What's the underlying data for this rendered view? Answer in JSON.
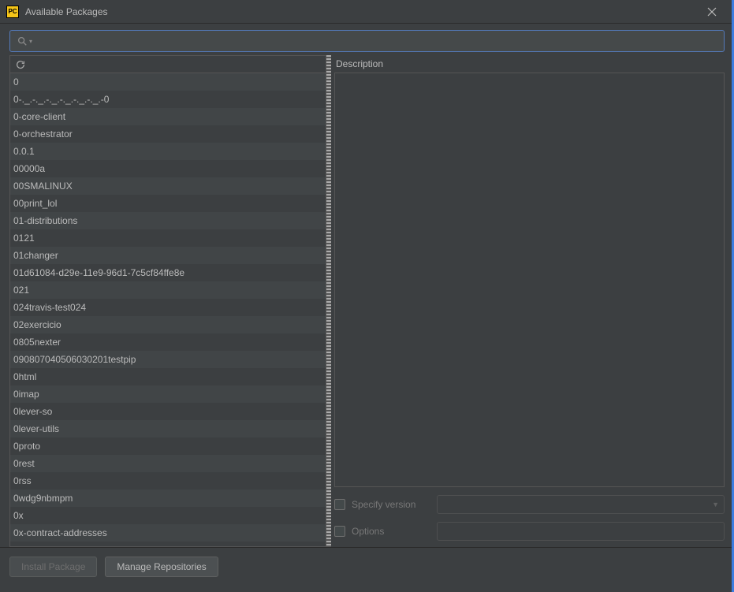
{
  "window": {
    "app_icon_text": "PC",
    "title": "Available Packages"
  },
  "search": {
    "value": "",
    "placeholder": ""
  },
  "packages": [
    "0",
    "0-._.-._.-._.-._.-._.-._.-0",
    "0-core-client",
    "0-orchestrator",
    "0.0.1",
    "00000a",
    "00SMALINUX",
    "00print_lol",
    "01-distributions",
    "0121",
    "01changer",
    "01d61084-d29e-11e9-96d1-7c5cf84ffe8e",
    "021",
    "024travis-test024",
    "02exercicio",
    "0805nexter",
    "090807040506030201testpip",
    "0html",
    "0imap",
    "0lever-so",
    "0lever-utils",
    "0proto",
    "0rest",
    "0rss",
    "0wdg9nbmpm",
    "0x",
    "0x-contract-addresses"
  ],
  "description": {
    "label": "Description",
    "content": ""
  },
  "options": {
    "specify_version": {
      "label": "Specify version",
      "checked": false,
      "value": ""
    },
    "options_field": {
      "label": "Options",
      "checked": false,
      "value": ""
    }
  },
  "buttons": {
    "install": "Install Package",
    "manage": "Manage Repositories"
  }
}
